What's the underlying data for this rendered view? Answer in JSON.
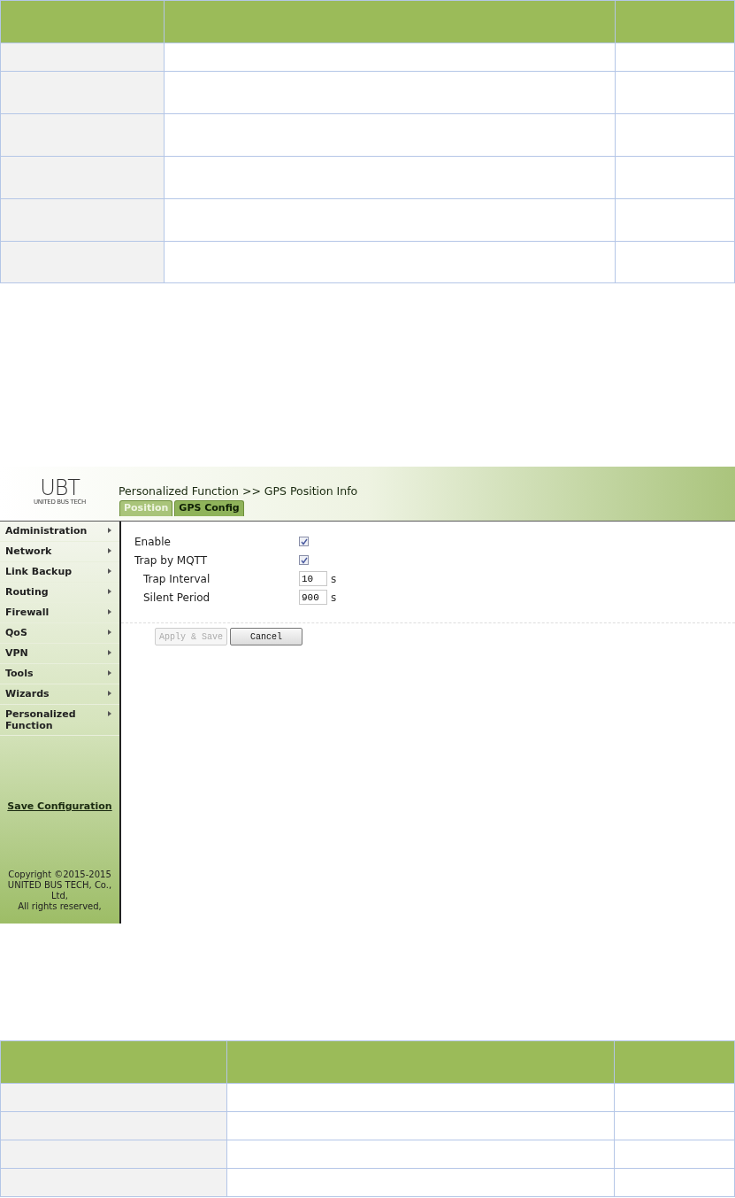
{
  "logo": {
    "mark": "UBT",
    "company": "UNITED BUS TECH"
  },
  "title": "Personalized Function >> GPS Position Info",
  "tabs": [
    {
      "label": "Position",
      "selected": false
    },
    {
      "label": "GPS Config",
      "selected": true
    }
  ],
  "sidebar": {
    "items": [
      {
        "label": "Administration"
      },
      {
        "label": "Network"
      },
      {
        "label": "Link Backup"
      },
      {
        "label": "Routing"
      },
      {
        "label": "Firewall"
      },
      {
        "label": "QoS"
      },
      {
        "label": "VPN"
      },
      {
        "label": "Tools"
      },
      {
        "label": "Wizards"
      },
      {
        "label": "Personalized Function"
      }
    ],
    "save_link": "Save Configuration",
    "copyright": [
      "Copyright ©2015-2015",
      "UNITED BUS TECH, Co.,",
      "Ltd,",
      "All rights reserved,"
    ]
  },
  "form": [
    {
      "kind": "checkbox",
      "label": "Enable",
      "checked": true
    },
    {
      "kind": "checkbox",
      "label": "Trap by MQTT",
      "checked": true
    },
    {
      "kind": "number",
      "label": "Trap Interval",
      "value": "10",
      "unit": "s"
    },
    {
      "kind": "number",
      "label": "Silent Period",
      "value": "900",
      "unit": "s"
    }
  ],
  "buttons": [
    {
      "label": "Apply & Save",
      "disabled": true
    },
    {
      "label": "Cancel",
      "disabled": false
    }
  ]
}
